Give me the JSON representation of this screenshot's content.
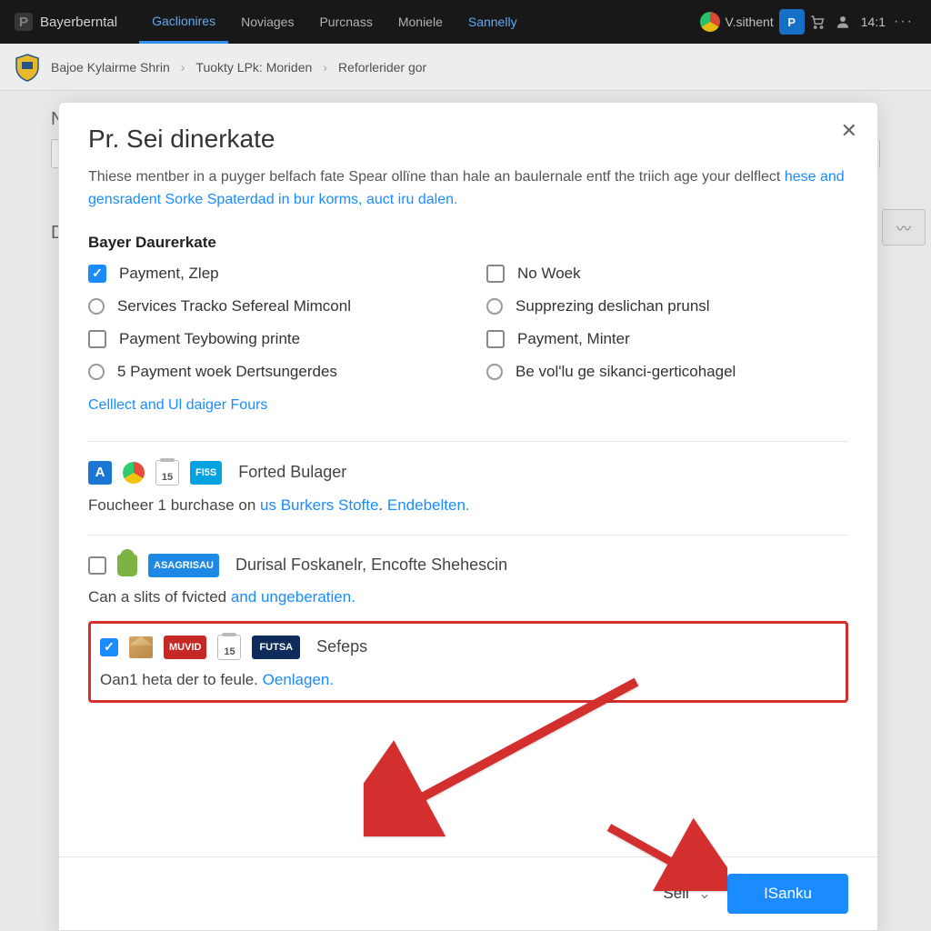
{
  "topbar": {
    "brand": "Bayerberntal",
    "brand_logo_letter": "P",
    "nav": [
      "Gaclionires",
      "Noviages",
      "Purcnass",
      "Moniele",
      "Sannelly"
    ],
    "nav_active_index": 0,
    "user_label": "V.sithent",
    "clock": "14:1"
  },
  "breadcrumb": {
    "items": [
      "Bajoe Kylairme Shrin",
      "Tuokty LPk: Moriden",
      "Reforlerider gor"
    ]
  },
  "bg": {
    "heading_initial": "N",
    "section_initial": "D"
  },
  "modal": {
    "title": "Pr. Sei dinerkate",
    "close_glyph": "✕",
    "desc_a": "Thiese mentber in a puyger belfach fate Spear ollïne than hale an baulernale entf the triich age your delflect",
    "desc_b": "hese and gensradent Sorke Spaterdad in bur korms, auct iru dalen.",
    "section_title": "Bayer Daurerkate",
    "options": {
      "left": [
        {
          "type": "check",
          "checked": true,
          "label": "Payment, Zlep"
        },
        {
          "type": "radio",
          "checked": false,
          "label": "Services Tracko Sefereal Mimconl"
        },
        {
          "type": "check",
          "checked": false,
          "label": "Payment Teybowing printe"
        },
        {
          "type": "radio",
          "checked": false,
          "label": "5 Payment woek Dertsungerdes"
        }
      ],
      "right": [
        {
          "type": "check",
          "checked": false,
          "label": "No Woek"
        },
        {
          "type": "radio",
          "checked": false,
          "label": "Supprezing deslichan prunsl"
        },
        {
          "type": "check",
          "checked": false,
          "label": "Payment, Minter"
        },
        {
          "type": "radio",
          "checked": false,
          "label": "Be vol'lu ge sikanci-gerticohagel"
        }
      ]
    },
    "more_link": "Celllect and Ul daiger Fours",
    "row1": {
      "badge_a": "A",
      "badge_fiss": "FI5S",
      "cal_day": "15",
      "label": "Forted Bulager",
      "sub_a": "Foucheer 1 burchase on",
      "sub_link1": "us Burkers Stofte",
      "sub_link2": "Endebelten."
    },
    "row2": {
      "badge_asag": "ASAGRISAU",
      "label": "Durisal Foskanelr, Encofte Shehescin",
      "sub_a": "Can a slits of fvicted",
      "sub_link": "and ungeberatien."
    },
    "row3": {
      "badge_mund": "MUVID",
      "badge_futsa": "FUTSA",
      "cal_day": "15",
      "label": "Sefeps",
      "sub_a": "Oan1 heta der to feule.",
      "sub_link": "Oenlagen."
    },
    "footer": {
      "select_label": "Sell",
      "primary": "ISanku"
    }
  }
}
